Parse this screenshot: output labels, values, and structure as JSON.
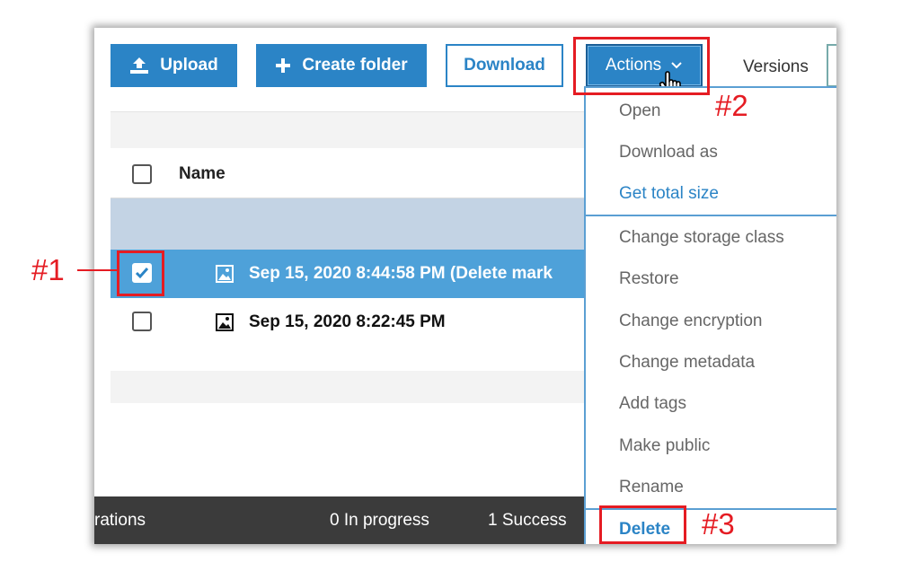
{
  "toolbar": {
    "upload_label": "Upload",
    "create_folder_label": "Create folder",
    "download_label": "Download",
    "actions_label": "Actions",
    "versions_label": "Versions"
  },
  "table": {
    "header_name": "Name",
    "rows": [
      {
        "label": "Sep 15, 2020 8:44:58 PM (Delete mark",
        "checked": true
      },
      {
        "label": "Sep 15, 2020 8:22:45 PM",
        "checked": false
      }
    ]
  },
  "menu": {
    "group1": [
      "Open",
      "Download as",
      "Get total size"
    ],
    "group2": [
      "Change storage class",
      "Restore",
      "Change encryption",
      "Change metadata",
      "Add tags",
      "Make public",
      "Rename"
    ],
    "delete_label": "Delete"
  },
  "status": {
    "operations": "rations",
    "in_progress": "0 In progress",
    "success": "1 Success"
  },
  "annotations": {
    "step1": "#1",
    "step2": "#2",
    "step3": "#3"
  },
  "colors": {
    "accent": "#2b84c6",
    "selected_row": "#4ea1d9",
    "annotation": "#e51c23",
    "status_bar": "#3b3b3b"
  }
}
